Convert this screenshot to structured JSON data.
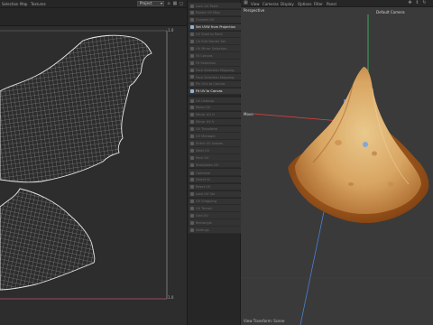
{
  "uv_editor": {
    "menu": [
      "Selection",
      "Map",
      "Textures"
    ],
    "mode_select": "Project",
    "ticks": {
      "top": "1.0",
      "bottom": "1.0"
    }
  },
  "commands": {
    "items_top": [
      "Lock UV Point",
      "Rotate UV Map",
      "Convert UV",
      "Set UVW from Projection",
      "UV Shell to Point",
      "UV Edit Border Sel",
      "UV Mirror Selection",
      "Fit Canvas",
      "Fit Selection",
      "Face Selection Mapping",
      "Face Selection Mapping",
      "Pin UVs to Canvas",
      "Fit UV to Canvas"
    ],
    "items_mid": [
      "UV Unwrap",
      "Relax UV",
      "Mirror UV H",
      "Mirror UV V",
      "UV Transform",
      "UV Manager",
      "Stitch UV Islands",
      "Weld UV",
      "Pack UV",
      "Straighten UV",
      "Rotate UV Islands"
    ],
    "items_bottom": [
      "Optimize",
      "Select Al",
      "Reset UV",
      "Lock UV Sel",
      "UV Snapping",
      "UV Terrain",
      "Grid UV",
      "Rectangle",
      "Settings"
    ],
    "active": [
      "Set UVW from Projection",
      "Fit UV to Canvas"
    ]
  },
  "viewport": {
    "menu": [
      "View",
      "Cameras",
      "Display",
      "Options",
      "Filter",
      "Panel"
    ],
    "view_name": "Perspective",
    "camera_name": "Default Camera",
    "gizmo_label": "Move",
    "footer": "View Transform: Scene"
  },
  "colors": {
    "uv_wire": "#d9d9d9",
    "object_orange": "#d98a3a",
    "axis_green": "#3ac46a",
    "axis_red": "#e2403f",
    "axis_blue": "#4a7fd6"
  }
}
